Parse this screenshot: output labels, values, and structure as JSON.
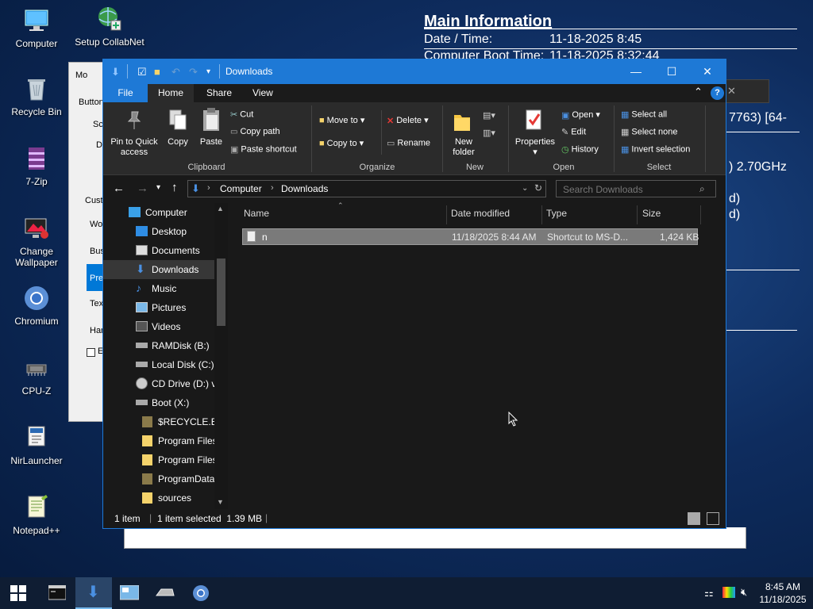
{
  "desktop": {
    "icons": [
      {
        "label": "Computer",
        "icon": "computer-icon"
      },
      {
        "label": "Setup CollabNet",
        "icon": "globe-setup-icon"
      },
      {
        "label": "Recycle Bin",
        "icon": "recycle-bin-icon"
      },
      {
        "label": "7-Zip",
        "icon": "archive-icon"
      },
      {
        "label": "Change Wallpaper",
        "icon": "wallpaper-icon"
      },
      {
        "label": "Chromium",
        "icon": "chromium-icon"
      },
      {
        "label": "CPU-Z",
        "icon": "cpu-icon"
      },
      {
        "label": "NirLauncher",
        "icon": "launcher-icon"
      },
      {
        "label": "Notepad++",
        "icon": "notepad-icon"
      }
    ]
  },
  "info_panel": {
    "title": "Main Information",
    "rows": [
      {
        "key": "Date / Time:",
        "value": "11-18-2025 8:45"
      },
      {
        "key": "Computer Boot Time:",
        "value": "11-18-2025 8:32:44"
      }
    ],
    "fragments": [
      "7763) [64-",
      ") 2.70GHz",
      "d)",
      "d)"
    ]
  },
  "background_dialog": {
    "fragments": [
      "Mo",
      "Button",
      "Sc",
      "De",
      "Cust",
      "Wo",
      "Bus",
      "Pre",
      "Tex",
      "Har",
      "E"
    ]
  },
  "explorer": {
    "title": "Downloads",
    "quick_access_icons": [
      "download-arrow-icon",
      "properties-check-icon",
      "new-folder-icon",
      "undo-icon",
      "redo-icon",
      "customize-dropdown-icon"
    ],
    "window_buttons": {
      "minimize": "—",
      "maximize": "☐",
      "close": "✕"
    },
    "ribbon_tabs": [
      "File",
      "Home",
      "Share",
      "View"
    ],
    "ribbon": {
      "clipboard": {
        "label": "Clipboard",
        "pin": "Pin to Quick access",
        "pin_line1": "Pin to Quick",
        "pin_line2": "access",
        "copy": "Copy",
        "paste": "Paste",
        "cut": "Cut",
        "copy_path": "Copy path",
        "paste_shortcut": "Paste shortcut"
      },
      "organize": {
        "label": "Organize",
        "move_to": "Move to",
        "copy_to": "Copy to",
        "delete": "Delete",
        "rename": "Rename"
      },
      "new": {
        "label": "New",
        "new_folder_line1": "New",
        "new_folder_line2": "folder"
      },
      "open": {
        "label": "Open",
        "properties": "Properties",
        "open": "Open",
        "edit": "Edit",
        "history": "History"
      },
      "select": {
        "label": "Select",
        "select_all": "Select all",
        "select_none": "Select none",
        "invert": "Invert selection"
      }
    },
    "address": {
      "crumbs": [
        "Computer",
        "Downloads"
      ],
      "search_placeholder": "Search Downloads"
    },
    "nav_pane": [
      {
        "label": "Computer",
        "icon": "computer-icon",
        "indent": 0
      },
      {
        "label": "Desktop",
        "icon": "desktop-icon",
        "indent": 1
      },
      {
        "label": "Documents",
        "icon": "documents-icon",
        "indent": 1
      },
      {
        "label": "Downloads",
        "icon": "downloads-icon",
        "indent": 1,
        "selected": true
      },
      {
        "label": "Music",
        "icon": "music-icon",
        "indent": 1
      },
      {
        "label": "Pictures",
        "icon": "pictures-icon",
        "indent": 1
      },
      {
        "label": "Videos",
        "icon": "videos-icon",
        "indent": 1
      },
      {
        "label": "RAMDisk (B:)",
        "icon": "drive-icon",
        "indent": 1
      },
      {
        "label": "Local Disk (C:)",
        "icon": "drive-icon",
        "indent": 1
      },
      {
        "label": "CD Drive (D:) v",
        "icon": "cd-drive-icon",
        "indent": 1
      },
      {
        "label": "Boot (X:)",
        "icon": "drive-icon",
        "indent": 1
      },
      {
        "label": "$RECYCLE.BIN",
        "icon": "folder-icon",
        "indent": 2
      },
      {
        "label": "Program Files",
        "icon": "folder-icon",
        "indent": 2
      },
      {
        "label": "Program Files",
        "icon": "folder-icon",
        "indent": 2
      },
      {
        "label": "ProgramData",
        "icon": "folder-icon",
        "indent": 2
      },
      {
        "label": "sources",
        "icon": "folder-icon",
        "indent": 2
      }
    ],
    "columns": [
      "Name",
      "Date modified",
      "Type",
      "Size"
    ],
    "files": [
      {
        "name": "n",
        "date": "11/18/2025 8:44 AM",
        "type": "Shortcut to MS-D...",
        "size": "1,424 KB"
      }
    ],
    "status": {
      "count": "1 item",
      "selected": "1 item selected  1.39 MB"
    }
  },
  "taskbar": {
    "items": [
      "start-icon",
      "terminal-icon",
      "downloads-explorer-icon",
      "control-panel-icon",
      "drive-icon",
      "chromium-icon"
    ],
    "tray_icons": [
      "network-icon",
      "color-icon",
      "volume-muted-icon"
    ],
    "time": "8:45 AM",
    "date": "11/18/2025"
  },
  "colors": {
    "accent": "#1e79d6",
    "explorer_bg": "#191919",
    "ribbon_bg": "#2b2b2b",
    "selected_row": "#7a7a7a"
  }
}
